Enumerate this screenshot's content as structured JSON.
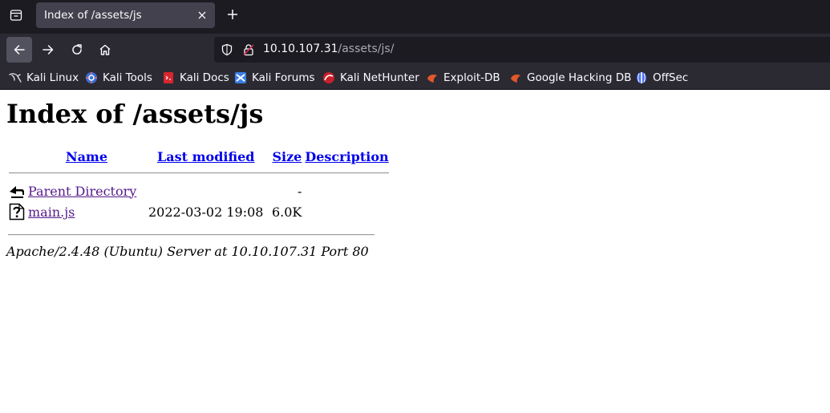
{
  "browser": {
    "tab": {
      "title": "Index of /assets/js"
    },
    "url": {
      "host": "10.10.107.31",
      "path": "/assets/js/"
    },
    "bookmarks": [
      {
        "label": "Kali Linux",
        "icon": "kali-dragon-icon"
      },
      {
        "label": "Kali Tools",
        "icon": "kali-tools-icon"
      },
      {
        "label": "Kali Docs",
        "icon": "kali-docs-icon"
      },
      {
        "label": "Kali Forums",
        "icon": "kali-forums-icon"
      },
      {
        "label": "Kali NetHunter",
        "icon": "kali-nethunter-icon"
      },
      {
        "label": "Exploit-DB",
        "icon": "exploit-db-icon"
      },
      {
        "label": "Google Hacking DB",
        "icon": "ghdb-icon"
      },
      {
        "label": "OffSec",
        "icon": "offsec-icon"
      }
    ]
  },
  "page": {
    "heading": "Index of /assets/js",
    "columns": {
      "name": "Name",
      "modified": "Last modified",
      "size": "Size",
      "description": "Description"
    },
    "rows": [
      {
        "name": "Parent Directory",
        "modified": "",
        "size": "-",
        "description": "",
        "icon": "back-folder-icon"
      },
      {
        "name": "main.js",
        "modified": "2022-03-02 19:08",
        "size": "6.0K",
        "description": "",
        "icon": "unknown-file-icon"
      }
    ],
    "footer": "Apache/2.4.48 (Ubuntu) Server at 10.10.107.31 Port 80"
  }
}
